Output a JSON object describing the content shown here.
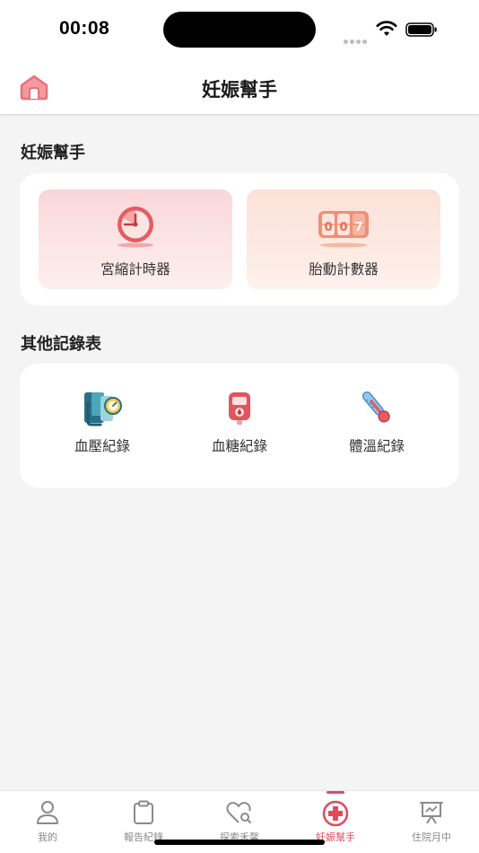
{
  "status_bar": {
    "time": "00:08"
  },
  "nav": {
    "title": "妊娠幫手",
    "home_icon": "house-icon"
  },
  "section_tools": {
    "title": "妊娠幫手",
    "items": [
      {
        "label": "宮縮計時器",
        "icon": "contraction-timer-icon"
      },
      {
        "label": "胎動計數器",
        "icon": "fetal-movement-counter-icon"
      }
    ]
  },
  "section_records": {
    "title": "其他記錄表",
    "items": [
      {
        "label": "血壓紀錄",
        "icon": "blood-pressure-icon"
      },
      {
        "label": "血糖紀錄",
        "icon": "blood-glucose-meter-icon"
      },
      {
        "label": "體溫紀錄",
        "icon": "thermometer-icon"
      }
    ]
  },
  "counter_digits": "007",
  "tab_bar": {
    "active_index": 3,
    "tabs": [
      {
        "label": "我的",
        "icon": "person-icon"
      },
      {
        "label": "報告紀錄",
        "icon": "clipboard-icon"
      },
      {
        "label": "探索禾馨",
        "icon": "heart-search-icon"
      },
      {
        "label": "妊娠幫手",
        "icon": "medical-cross-icon"
      },
      {
        "label": "住院月中",
        "icon": "presentation-board-icon"
      }
    ]
  },
  "colors": {
    "accent": "#e24a5a",
    "background": "#f4f4f4",
    "tile_pink": "#fbdde0",
    "tile_peach": "#fde6de"
  }
}
